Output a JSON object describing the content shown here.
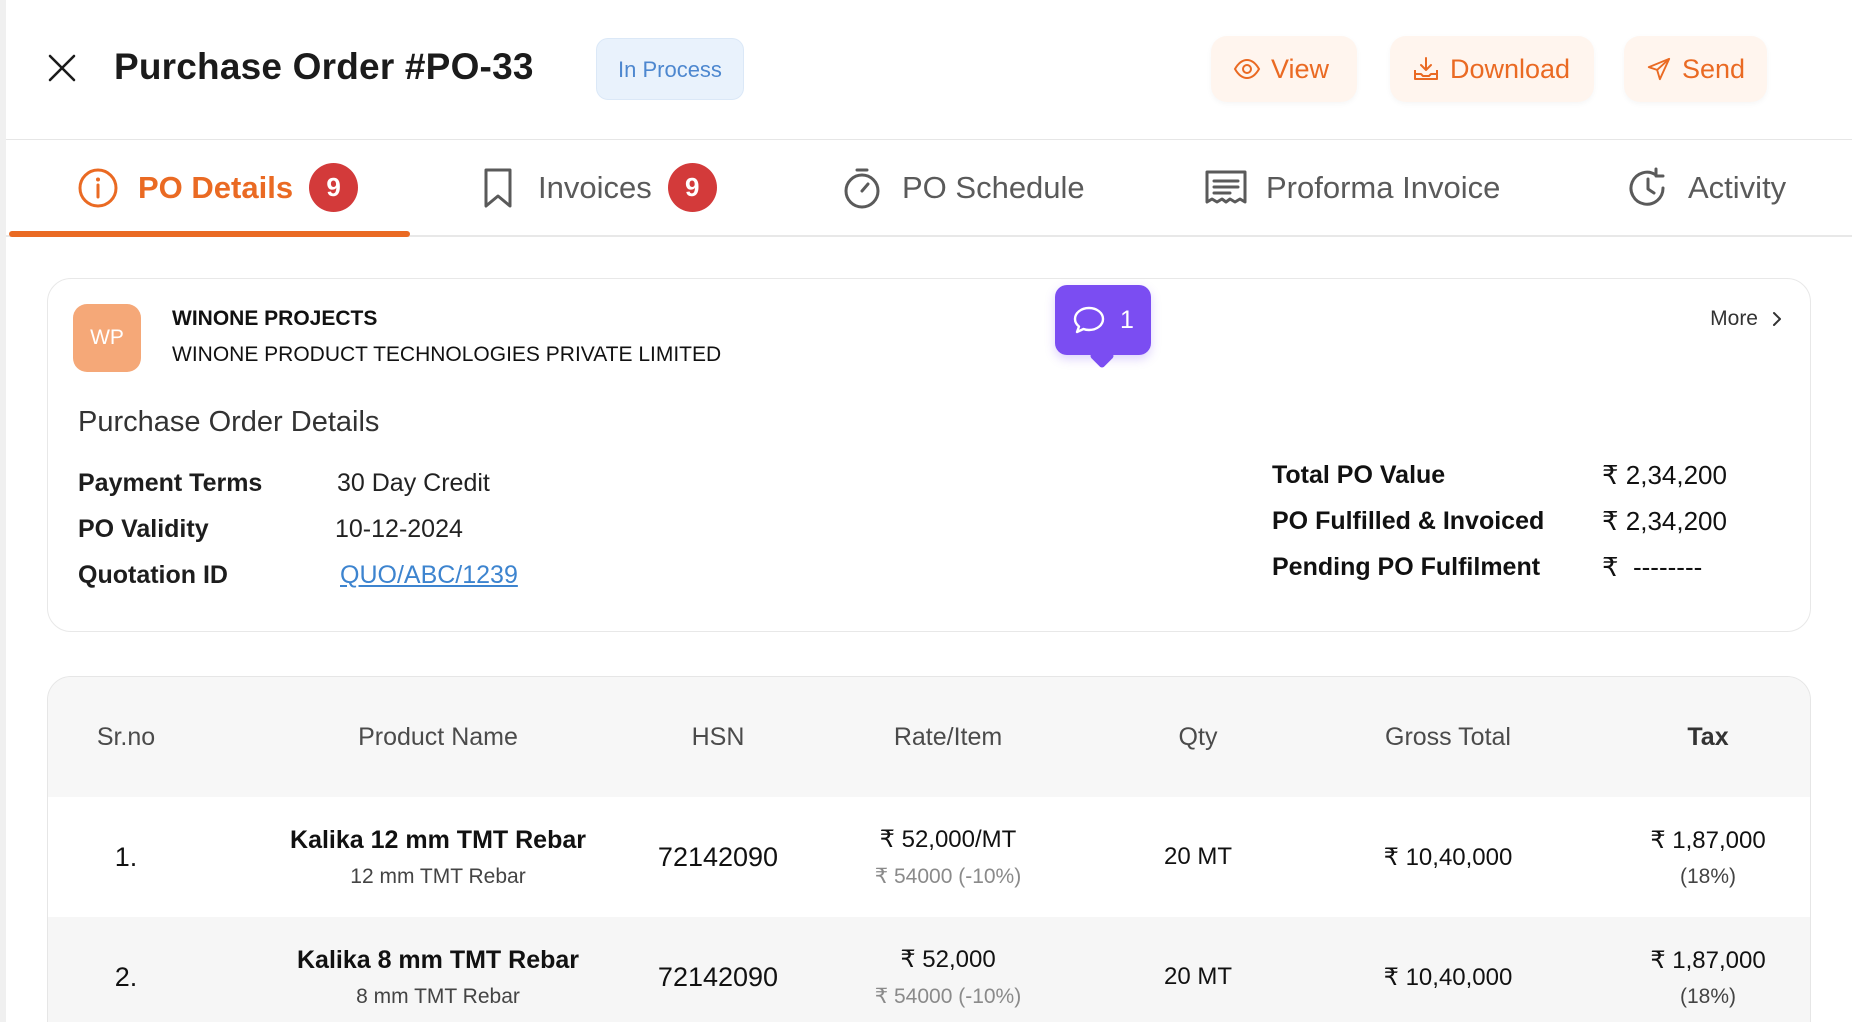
{
  "header": {
    "title": "Purchase Order #PO-33",
    "status": "In Process",
    "buttons": {
      "view": "View",
      "download": "Download",
      "send": "Send"
    }
  },
  "tabs": [
    {
      "label": "PO Details",
      "badge": "9",
      "active": true,
      "icon": "info-icon"
    },
    {
      "label": "Invoices",
      "badge": "9",
      "icon": "bookmark-icon"
    },
    {
      "label": "PO Schedule",
      "icon": "stopwatch-icon"
    },
    {
      "label": "Proforma Invoice",
      "icon": "receipt-icon"
    },
    {
      "label": "Activity",
      "icon": "history-icon"
    }
  ],
  "vendor": {
    "initials": "WP",
    "name": "WINONE PROJECTS",
    "legal_name": "WINONE PRODUCT TECHNOLOGIES PRIVATE LIMITED",
    "more_label": "More"
  },
  "comment": {
    "count": "1"
  },
  "details": {
    "title": "Purchase Order Details",
    "payment_terms_label": "Payment Terms",
    "payment_terms": "30 Day Credit",
    "validity_label": "PO Validity",
    "validity": "10-12-2024",
    "quotation_label": "Quotation ID",
    "quotation_id": "QUO/ABC/1239"
  },
  "summary": {
    "total_label": "Total PO Value",
    "total_value": "₹ 2,34,200",
    "fulfilled_label": "PO Fulfilled & Invoiced",
    "fulfilled_value": "₹ 2,34,200",
    "pending_label": "Pending PO Fulfilment",
    "pending_value": "₹  --------"
  },
  "table": {
    "headers": [
      "Sr.no",
      "Product Name",
      "HSN",
      "Rate/Item",
      "Qty",
      "Gross Total",
      "Tax"
    ],
    "rows": [
      {
        "sr": "1.",
        "product": "Kalika 12 mm TMT Rebar",
        "product_sub": "12 mm TMT Rebar",
        "hsn": "72142090",
        "rate": "₹ 52,000/MT",
        "rate_sub": "₹ 54000 (-10%)",
        "qty": "20 MT",
        "gross": "₹ 10,40,000",
        "tax": "₹ 1,87,000",
        "tax_sub": "(18%)"
      },
      {
        "sr": "2.",
        "product": "Kalika 8 mm TMT Rebar",
        "product_sub": "8 mm TMT Rebar",
        "hsn": "72142090",
        "rate": "₹ 52,000",
        "rate_sub": "₹ 54000 (-10%)",
        "qty": "20 MT",
        "gross": "₹ 10,40,000",
        "tax": "₹ 1,87,000",
        "tax_sub": "(18%)"
      }
    ]
  },
  "colors": {
    "accent": "#ea6a23",
    "badge": "#d33a3a",
    "comment": "#7b4df2",
    "status_bg": "#e9f2fc",
    "status_text": "#4d87cf",
    "link": "#3d84cf"
  }
}
